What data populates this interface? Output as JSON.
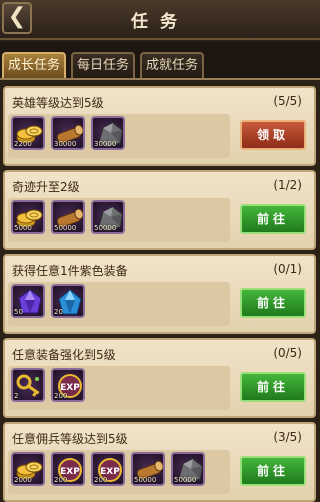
{
  "header": {
    "title": "任务",
    "back_glyph": "❮"
  },
  "tabs": [
    {
      "label": "成长任务",
      "active": true
    },
    {
      "label": "每日任务",
      "active": false
    },
    {
      "label": "成就任务",
      "active": false
    }
  ],
  "colors": {
    "claim_button": "#b9452b",
    "go_button": "#3aa52f",
    "card_bg": "#ecdcbc"
  },
  "tasks": [
    {
      "title": "英雄等级达到5级",
      "progress": "(5/5)",
      "button": "领取",
      "button_type": "claim",
      "rewards": [
        {
          "icon": "gold-coins-icon",
          "qty": "2200"
        },
        {
          "icon": "wood-log-icon",
          "qty": "30000"
        },
        {
          "icon": "stone-ore-icon",
          "qty": "30000"
        }
      ]
    },
    {
      "title": "奇迹升至2级",
      "progress": "(1/2)",
      "button": "前往",
      "button_type": "go",
      "rewards": [
        {
          "icon": "gold-coins-icon",
          "qty": "5000"
        },
        {
          "icon": "wood-log-icon",
          "qty": "50000"
        },
        {
          "icon": "stone-ore-icon",
          "qty": "50000"
        }
      ]
    },
    {
      "title": "获得任意1件紫色装备",
      "progress": "(0/1)",
      "button": "前往",
      "button_type": "go",
      "rewards": [
        {
          "icon": "purple-gem-icon",
          "qty": "50"
        },
        {
          "icon": "blue-gem-icon",
          "qty": "20"
        }
      ]
    },
    {
      "title": "任意装备强化到5级",
      "progress": "(0/5)",
      "button": "前往",
      "button_type": "go",
      "rewards": [
        {
          "icon": "key-icon",
          "qty": "2"
        },
        {
          "icon": "exp-icon",
          "qty": "200"
        }
      ]
    },
    {
      "title": "任意佣兵等级达到5级",
      "progress": "(3/5)",
      "button": "前往",
      "button_type": "go",
      "rewards": [
        {
          "icon": "gold-coins-icon",
          "qty": "2000"
        },
        {
          "icon": "exp-icon",
          "qty": "200"
        },
        {
          "icon": "exp-icon",
          "qty": "200"
        },
        {
          "icon": "wood-log-icon",
          "qty": "50000"
        },
        {
          "icon": "stone-ore-icon",
          "qty": "50000"
        }
      ]
    }
  ]
}
